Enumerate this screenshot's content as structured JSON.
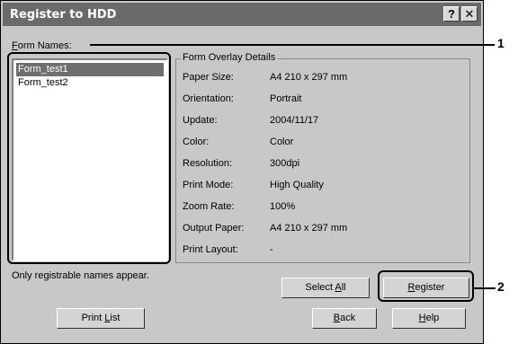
{
  "window": {
    "title": "Register to HDD",
    "help_glyph": "?",
    "close_glyph": "✕"
  },
  "form_names": {
    "label": "Form Names:",
    "items": [
      "Form_test1",
      "Form_test2"
    ],
    "selected_index": 0,
    "hint": "Only registrable names appear."
  },
  "details": {
    "title": "Form Overlay Details",
    "rows": [
      {
        "label": "Paper Size:",
        "value": "A4 210 x 297 mm"
      },
      {
        "label": "Orientation:",
        "value": "Portrait"
      },
      {
        "label": "Update:",
        "value": "2004/11/17"
      },
      {
        "label": "Color:",
        "value": "Color"
      },
      {
        "label": "Resolution:",
        "value": "300dpi"
      },
      {
        "label": "Print Mode:",
        "value": "High Quality"
      },
      {
        "label": "Zoom Rate:",
        "value": "100%"
      },
      {
        "label": "Output Paper:",
        "value": "A4 210 x 297 mm"
      },
      {
        "label": "Print Layout:",
        "value": "-"
      }
    ]
  },
  "buttons": {
    "select_all": "Select All",
    "register": "Register",
    "print_list": "Print List",
    "back": "Back",
    "help": "Help"
  },
  "callouts": [
    "1",
    "2"
  ]
}
